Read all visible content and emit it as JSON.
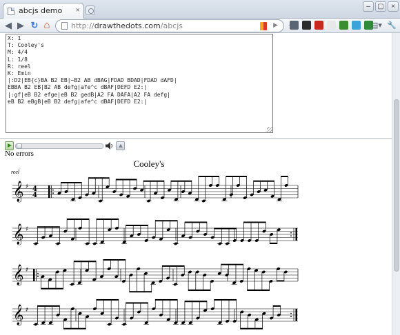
{
  "browser": {
    "tab_title": "abcjs demo",
    "tab_close_glyph": "×",
    "url_prefix": "http://",
    "url_host": "drawthedots.com",
    "url_path": "/abcjs",
    "window_controls": [
      "–",
      "▢",
      "×"
    ]
  },
  "nav": {
    "back_glyph": "◀",
    "forward_glyph": "▶",
    "reload_glyph": "↻",
    "home_glyph": "⌂",
    "star_glyph": "☆",
    "go_glyph": "▶"
  },
  "extensions": [
    {
      "name": "grid-extension-icon",
      "color": "#5a6472"
    },
    {
      "name": "plus-extension-icon",
      "color": "#2b2b2b"
    },
    {
      "name": "bookmark-extension-icon",
      "color": "#c8281e"
    },
    {
      "name": "page-extension-icon",
      "color": "#e8e8e8"
    },
    {
      "name": "feed-extension-icon",
      "color": "#3c8d2f"
    },
    {
      "name": "twitter-extension-icon",
      "color": "#3aa3d8"
    },
    {
      "name": "evernote-extension-icon",
      "color": "#2f8a3a"
    }
  ],
  "menus": {
    "page_glyph": "▤▾",
    "tools_glyph": "🔧▾"
  },
  "editor": {
    "text": "X: 1\nT: Cooley's\nM: 4/4\nL: 1/8\nR: reel\nK: Emin\n|:D2|EB{c}BA B2 EB|~B2 AB dBAG|FDAD BDAD|FDAD dAFD|\nEBBA B2 EB|B2 AB defg|afe^c dBAF|DEFD E2:|\n|:gf|eB B2 efge|eB B2 gedB|A2 FA DAFA|A2 FA defg|\neB B2 eBgB|eB B2 defg|afe^c dBAF|DEFD E2:|"
  },
  "player": {
    "progress": 0.0
  },
  "status": {
    "errors_text": "No errors"
  },
  "score": {
    "title": "Cooley's",
    "rhythm": "reel",
    "key_signature": "1 sharp (E minor)",
    "time_signature": {
      "beats": "4",
      "unit": "4"
    },
    "systems": 4
  }
}
